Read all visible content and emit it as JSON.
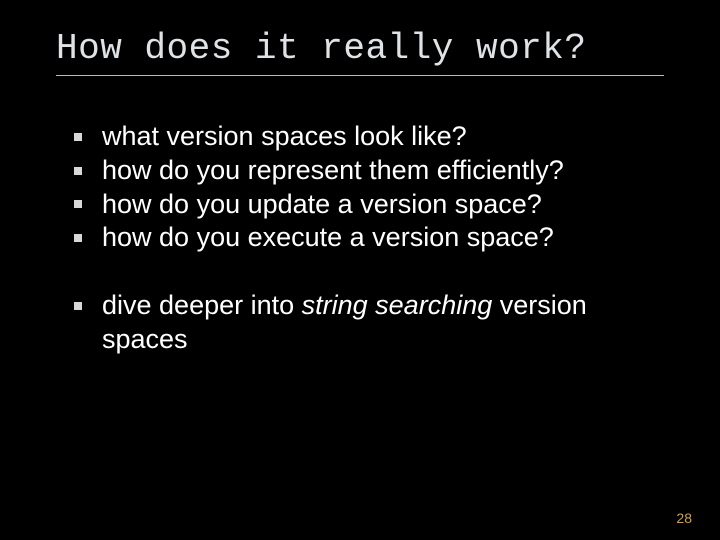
{
  "title": "How does it really work?",
  "bullets_group1": [
    "what version spaces look like?",
    "how do you represent them efficiently?",
    "how do you update a version space?",
    "how do you execute a version space?"
  ],
  "bullets_group2": {
    "prefix": "dive deeper into ",
    "emphasis": "string searching",
    "suffix": " version spaces"
  },
  "page_number": "28"
}
